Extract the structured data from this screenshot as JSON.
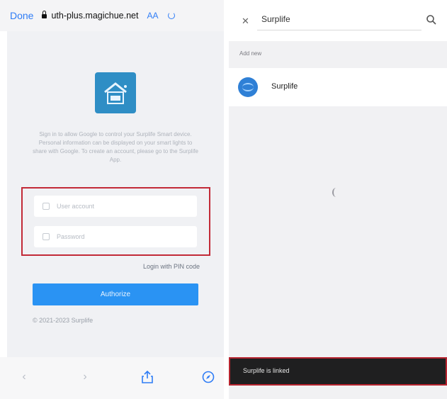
{
  "left": {
    "done_label": "Done",
    "url": "uth-plus.magichue.net",
    "aa_label": "AA",
    "description": "Sign in to allow Google to control your Surplife Smart device. Personal information can be displayed on your smart lights to share with Google. To create an account, please go to the Surplife App.",
    "username_placeholder": "User account",
    "password_placeholder": "Password",
    "pin_login_label": "Login with PIN code",
    "authorize_label": "Authorize",
    "copyright": "© 2021-2023 Surplife"
  },
  "right": {
    "search_query": "Surplife",
    "section_label": "Add new",
    "app_name": "Surplife",
    "toast_text": "Surplife is linked"
  },
  "colors": {
    "accent": "#2a93f3",
    "highlight_red": "#c22a37"
  }
}
